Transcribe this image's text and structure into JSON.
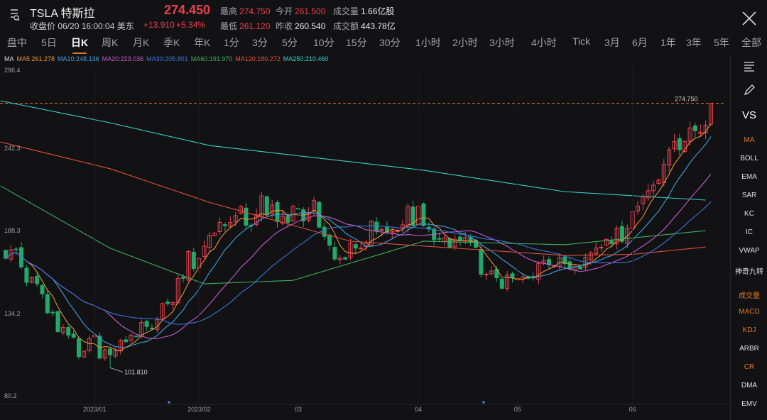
{
  "header": {
    "symbol": "TSLA 特斯拉",
    "price": "274.450",
    "status": "收盘价 06/20 16:00:04 美东",
    "change": "+13.910",
    "change_pct": "+5.34%",
    "high_label": "最高",
    "high": "274.750",
    "open_label": "今开",
    "open": "261.500",
    "volume_label": "成交量",
    "volume": "1.66亿股",
    "low_label": "最低",
    "low": "261.120",
    "prev_close_label": "昨收",
    "prev_close": "260.540",
    "turnover_label": "成交额",
    "turnover": "443.78亿"
  },
  "tabs": [
    "盘中",
    "5日",
    "日K",
    "周K",
    "月K",
    "季K",
    "年K",
    "1分",
    "3分",
    "5分",
    "10分",
    "15分",
    "30分",
    "1小时",
    "2小时",
    "3小时",
    "4小时",
    "Tick",
    "3月",
    "6月",
    "1年",
    "3年",
    "5年",
    "全部"
  ],
  "active_tab": "日K",
  "ma_legend": {
    "label": "MA",
    "items": [
      {
        "text": "MA5:261.278",
        "color": "#e8913a"
      },
      {
        "text": "MA10:248.136",
        "color": "#3fa0e0"
      },
      {
        "text": "MA20:223.036",
        "color": "#c45ccf"
      },
      {
        "text": "MA30:205.801",
        "color": "#3a74d8"
      },
      {
        "text": "MA60:191.970",
        "color": "#3fae5f"
      },
      {
        "text": "MA120:180.272",
        "color": "#e0503c"
      },
      {
        "text": "MA250:210.460",
        "color": "#3ad0c8"
      }
    ]
  },
  "sidebar": {
    "items": [
      {
        "label": "VS",
        "color": "#ffffff"
      },
      {
        "label": "MA",
        "color": "#e0762e"
      },
      {
        "label": "BOLL",
        "color": "#e0e0e0"
      },
      {
        "label": "EMA",
        "color": "#e0e0e0"
      },
      {
        "label": "SAR",
        "color": "#e0e0e0"
      },
      {
        "label": "KC",
        "color": "#e0e0e0"
      },
      {
        "label": "IC",
        "color": "#e0e0e0"
      },
      {
        "label": "VWAP",
        "color": "#e0e0e0"
      },
      {
        "label": "神奇九转",
        "color": "#e0e0e0"
      },
      {
        "label": "成交量",
        "color": "#e0762e"
      },
      {
        "label": "MACD",
        "color": "#e0762e"
      },
      {
        "label": "KDJ",
        "color": "#e0762e"
      },
      {
        "label": "ARBR",
        "color": "#e0e0e0"
      },
      {
        "label": "CR",
        "color": "#e0762e"
      },
      {
        "label": "DMA",
        "color": "#e0e0e0"
      },
      {
        "label": "EMV",
        "color": "#e0e0e0"
      }
    ]
  },
  "chart_data": {
    "type": "candlestick",
    "y_axis_labels": [
      "296.4",
      "242.3",
      "188.3",
      "134.2",
      "80.2"
    ],
    "ylim": [
      80.2,
      296.4
    ],
    "x_axis_labels": [
      {
        "text": "2023/01",
        "index": 17
      },
      {
        "text": "2023/02",
        "index": 37
      },
      {
        "text": "03",
        "index": 56
      },
      {
        "text": "04",
        "index": 79
      },
      {
        "text": "05",
        "index": 98
      },
      {
        "text": "06",
        "index": 120
      }
    ],
    "high_marker": {
      "text": "274.750",
      "value": 274.75
    },
    "low_marker": {
      "text": "101.810",
      "value": 101.81,
      "index": 20
    },
    "up_color": "#e8414d",
    "down_color": "#22a86a",
    "closes": [
      173.4,
      179.0,
      179.1,
      167.8,
      157.7,
      160.9,
      156.8,
      150.2,
      137.8,
      137.6,
      125.4,
      128.2,
      123.2,
      121.8,
      109.1,
      112.7,
      121.1,
      123.2,
      108.1,
      113.6,
      110.3,
      113.1,
      119.8,
      118.9,
      123.2,
      122.4,
      131.5,
      128.8,
      127.2,
      133.4,
      143.8,
      143.9,
      144.4,
      160.3,
      160.3,
      177.9,
      166.7,
      173.2,
      181.4,
      188.3,
      189.9,
      196.9,
      194.8,
      196.9,
      201.3,
      207.3,
      195.0,
      194.6,
      202.0,
      214.2,
      202.0,
      208.3,
      197.4,
      200.9,
      196.9,
      207.6,
      205.7,
      197.8,
      202.8,
      211.1,
      193.8,
      187.7,
      182.0,
      172.9,
      173.4,
      172.9,
      183.3,
      180.1,
      180.1,
      183.3,
      197.6,
      191.2,
      192.2,
      190.4,
      190.9,
      191.8,
      195.3,
      207.5,
      194.8,
      207.5,
      194.8,
      192.6,
      185.5,
      185.9,
      186.8,
      180.5,
      185.9,
      185.0,
      187.0,
      184.3,
      180.6,
      162.9,
      163.0,
      165.1,
      160.7,
      153.8,
      162.5,
      160.7,
      160.2,
      161.2,
      160.3,
      160.6,
      170.1,
      171.8,
      169.2,
      168.5,
      173.9,
      169.9,
      166.4,
      167.9,
      166.5,
      173.9,
      176.9,
      180.1,
      180.6,
      185.8,
      182.9,
      193.2,
      184.5,
      193.2,
      203.9,
      207.5,
      213.9,
      217.6,
      221.3,
      224.6,
      234.9,
      244.4,
      249.8,
      244.4,
      249.8,
      258.7,
      256.8,
      255.9,
      260.5,
      274.5
    ],
    "long_mas": [
      {
        "name": "MA60",
        "color": "#3fae5f",
        "points": [
          [
            -1,
            220.8
          ],
          [
            20,
            180
          ],
          [
            38,
            156.7
          ],
          [
            55,
            159
          ],
          [
            80,
            184.6
          ],
          [
            107,
            182.3
          ],
          [
            134,
            191.5
          ]
        ]
      },
      {
        "name": "MA120",
        "color": "#e0503c",
        "points": [
          [
            -1,
            249.5
          ],
          [
            20,
            232
          ],
          [
            39,
            210
          ],
          [
            66,
            184.6
          ],
          [
            107,
            175.3
          ],
          [
            120,
            176
          ],
          [
            134,
            180.8
          ]
        ]
      },
      {
        "name": "MA250",
        "color": "#3ad0c8",
        "points": [
          [
            -1,
            276.4
          ],
          [
            20,
            262
          ],
          [
            39,
            247.2
          ],
          [
            80,
            231
          ],
          [
            107,
            217
          ],
          [
            134,
            211.5
          ]
        ]
      }
    ]
  }
}
